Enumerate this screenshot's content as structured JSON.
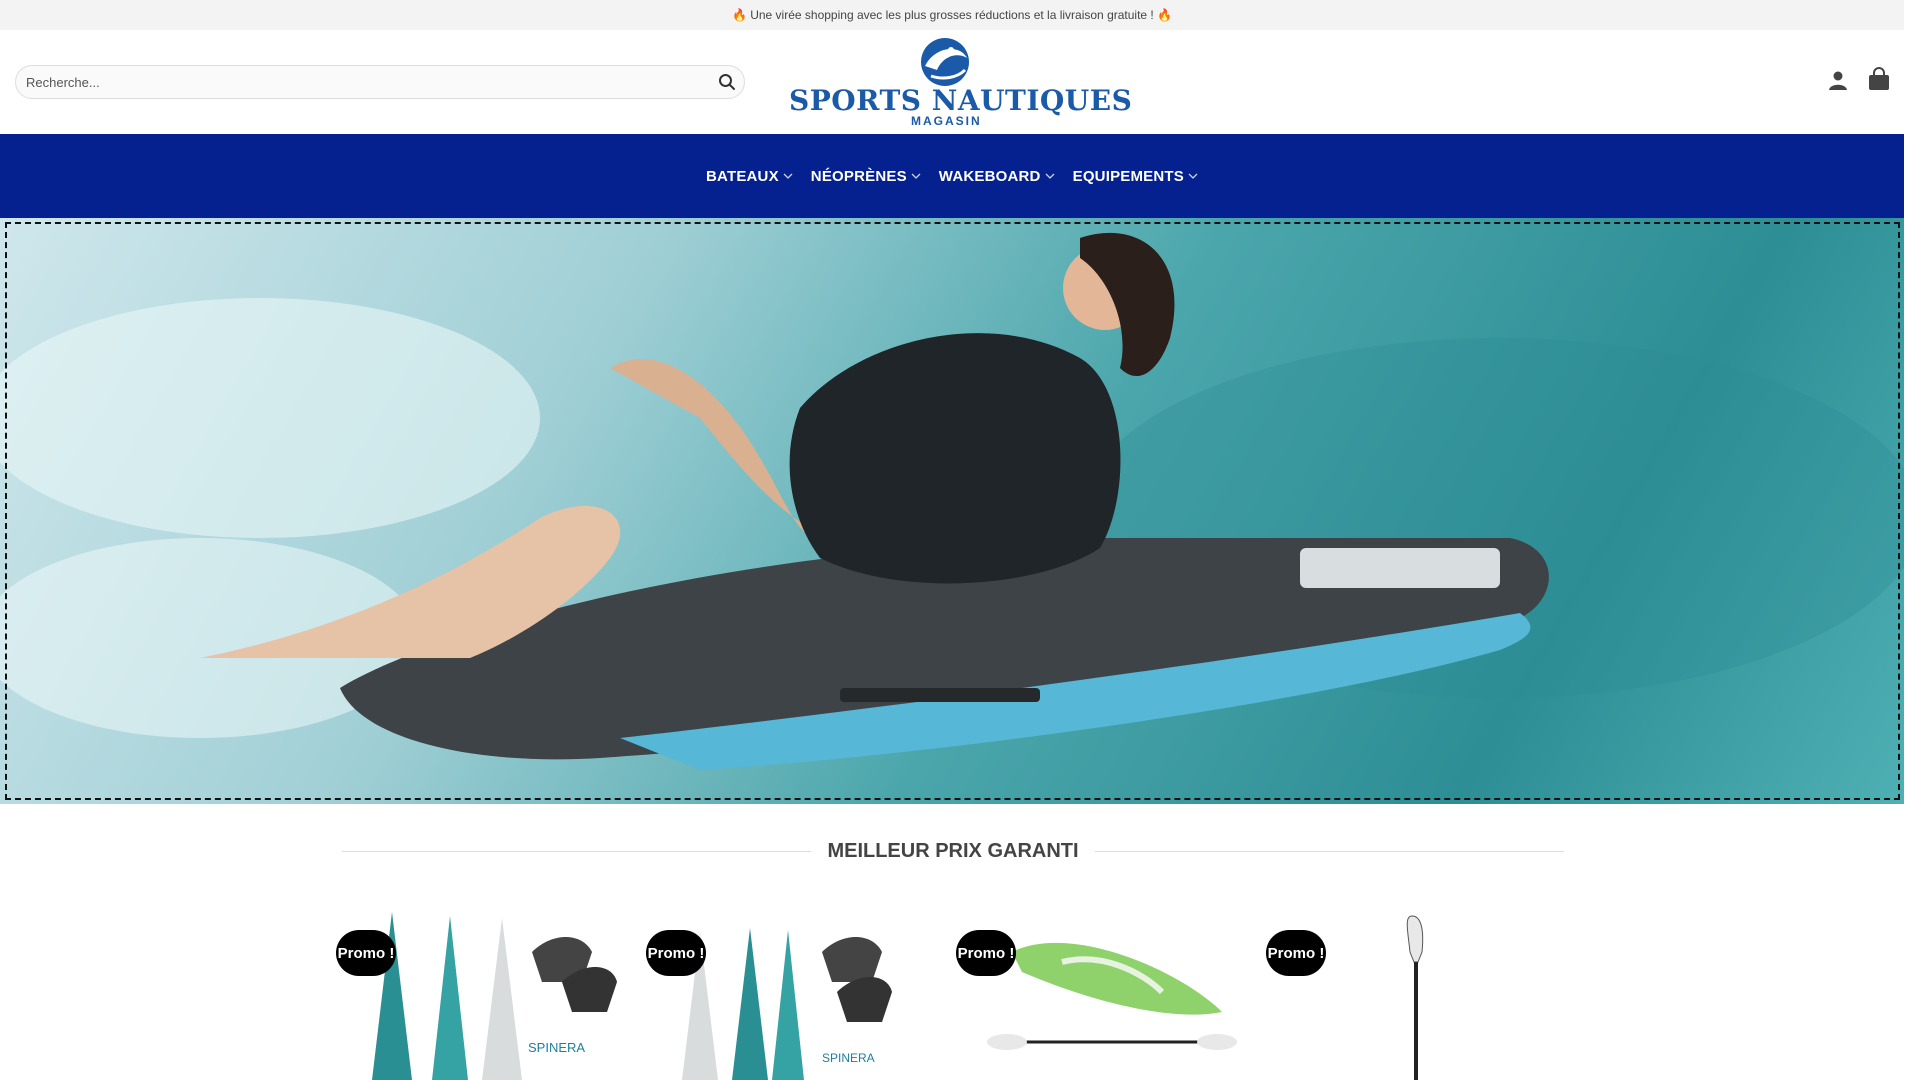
{
  "topbar": {
    "message": "🔥 Une virée shopping avec les plus grosses réductions et la livraison gratuite ! 🔥"
  },
  "header": {
    "search_placeholder": "Recherche...",
    "logo_main": "SPORTS NAUTIQUES",
    "logo_sub": "MAGASIN"
  },
  "nav": {
    "items": [
      {
        "label": "BATEAUX"
      },
      {
        "label": "NÉOPRÈNES"
      },
      {
        "label": "WAKEBOARD"
      },
      {
        "label": "EQUIPEMENTS"
      }
    ]
  },
  "section": {
    "title": "MEILLEUR PRIX GARANTI"
  },
  "products": [
    {
      "badge": "Promo !",
      "brand": "SPINERA"
    },
    {
      "badge": "Promo !",
      "brand": "SPINERA"
    },
    {
      "badge": "Promo !",
      "brand": ""
    },
    {
      "badge": "Promo !",
      "brand": ""
    }
  ],
  "colors": {
    "nav_bg": "#04218f",
    "logo": "#1a5aa8",
    "badge": "#000000"
  },
  "icons": [
    "search-icon",
    "user-icon",
    "shopping-bag-icon",
    "chevron-down-icon"
  ]
}
